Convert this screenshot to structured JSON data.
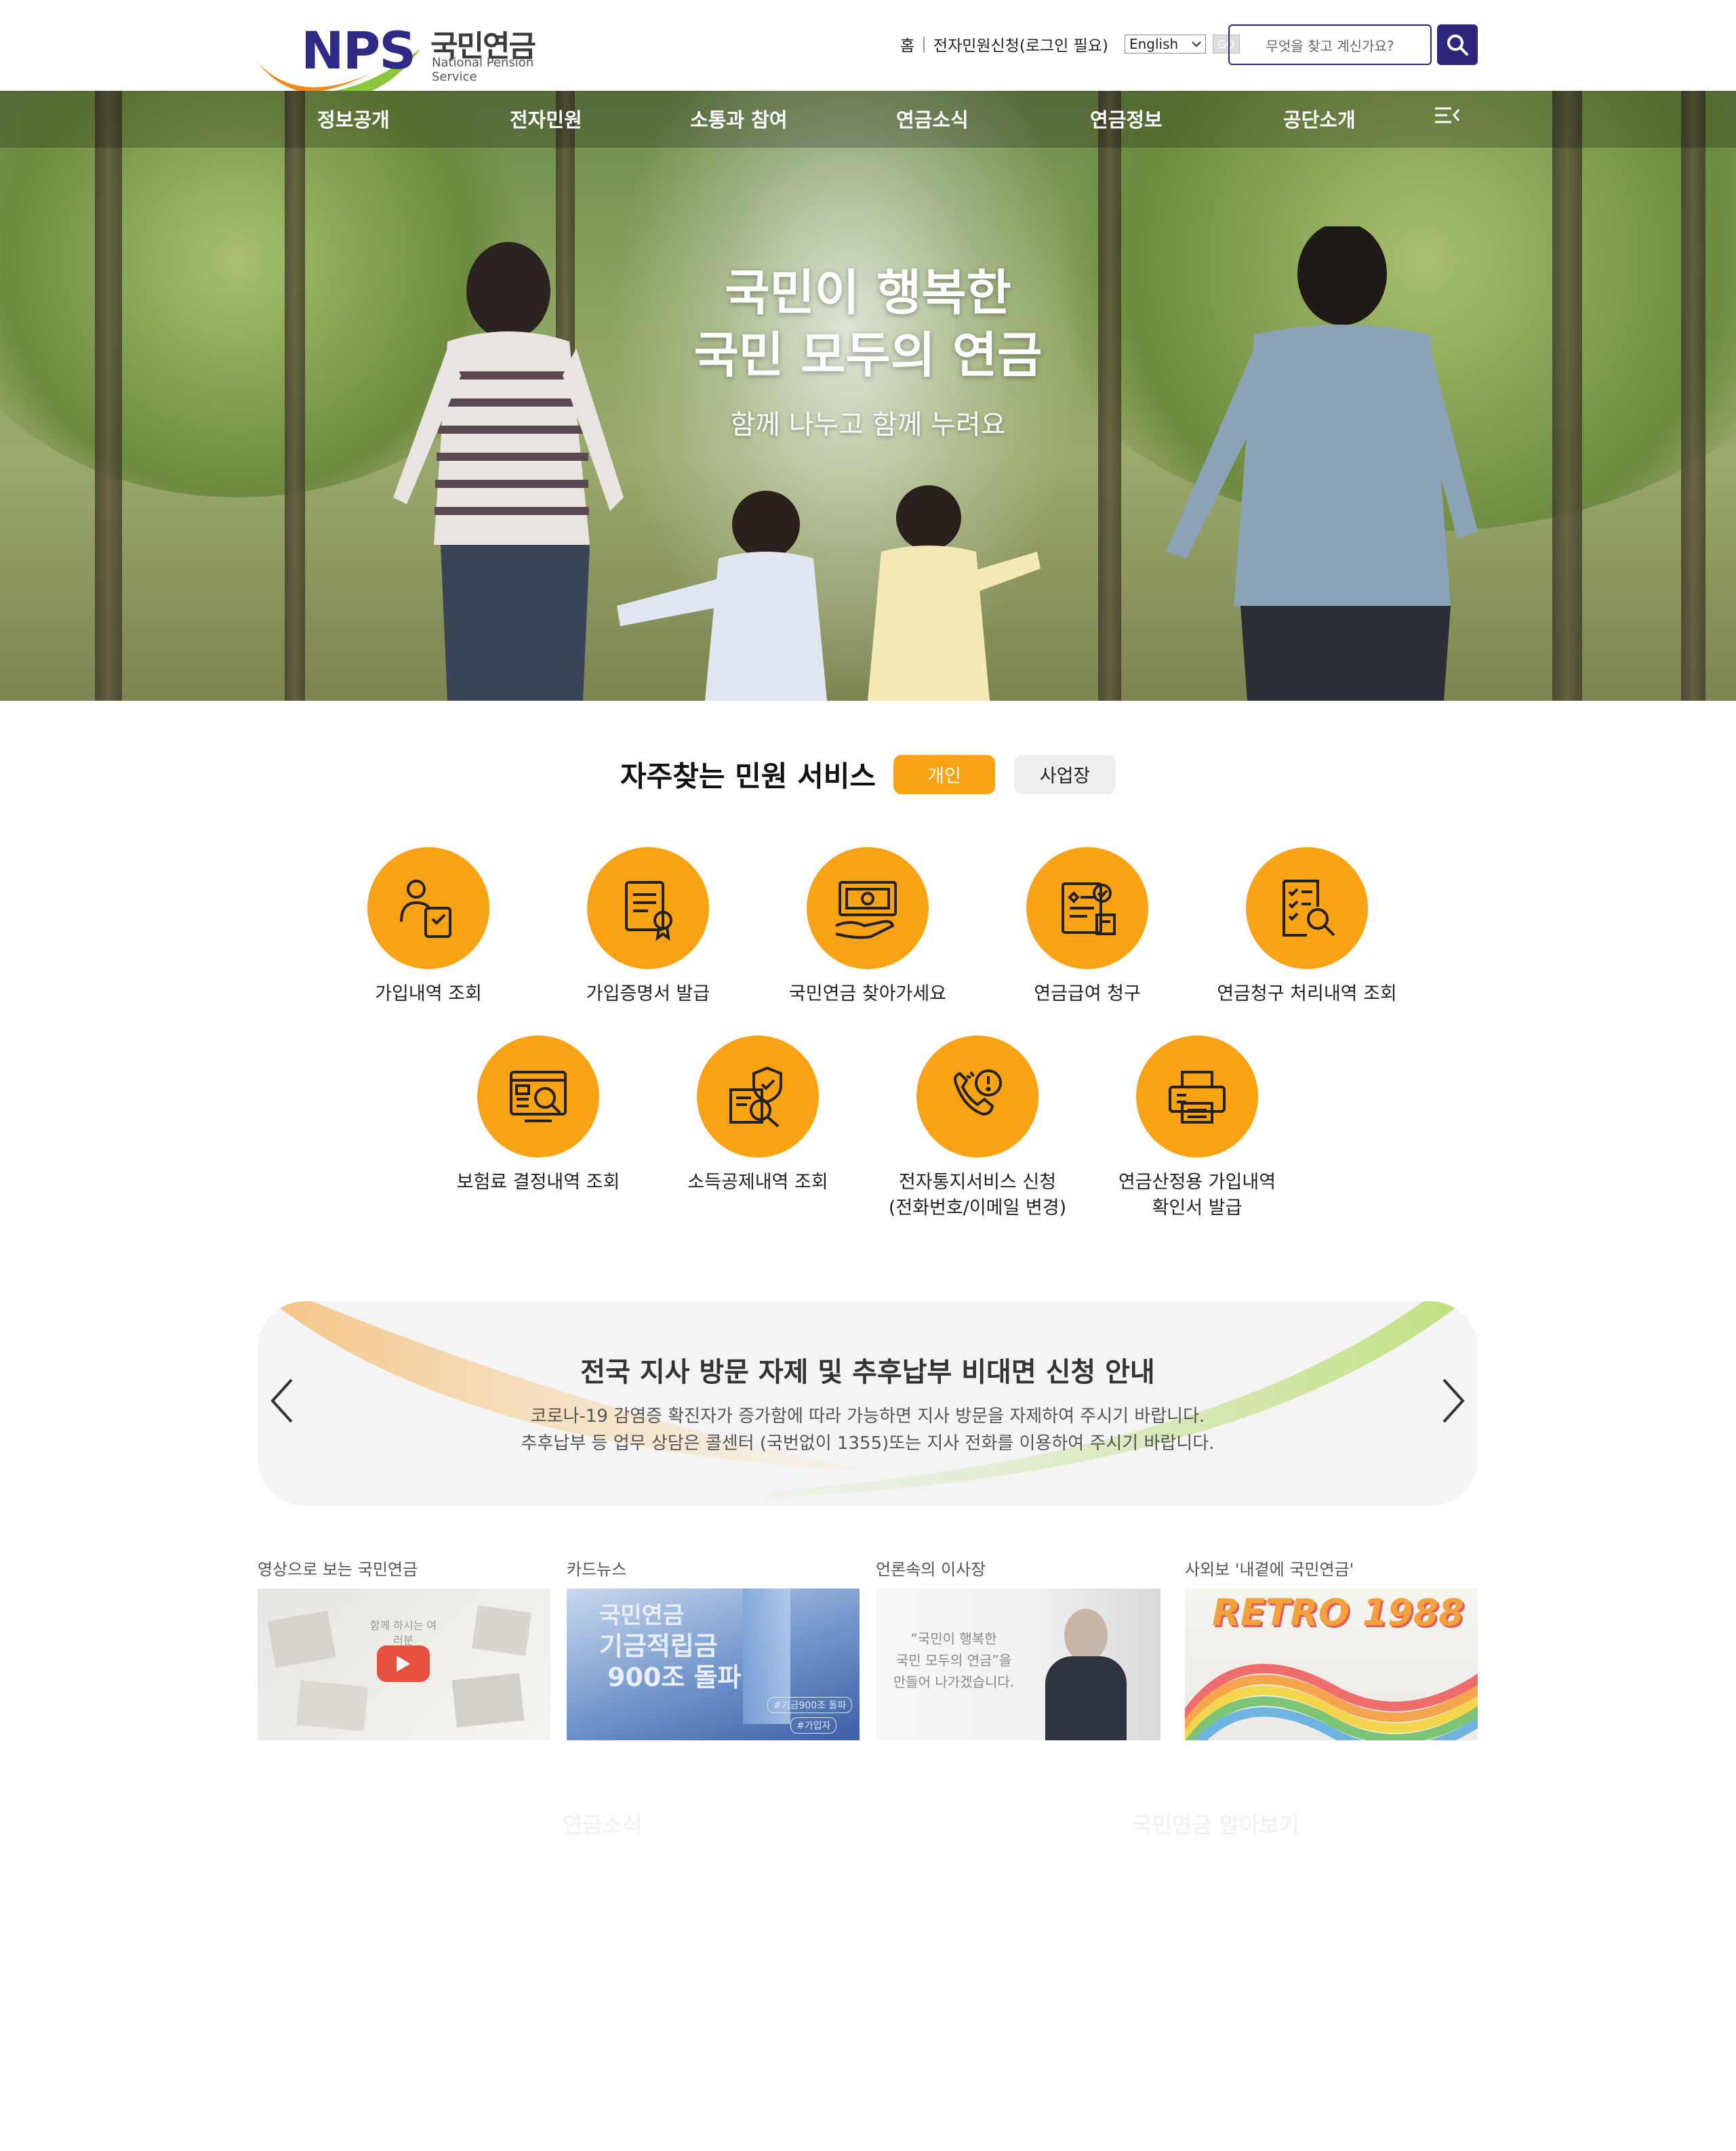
{
  "header": {
    "logo_letters": "NPS",
    "logo_ko": "국민연금",
    "logo_en": "National Pension Service",
    "util_home": "홈",
    "util_eservice": "전자민원신청(로그인 필요)",
    "language_selected": "English",
    "go_label": "GO",
    "search_placeholder": "무엇을 찾고 계신가요?",
    "brand_color": "#2e2679",
    "accent_color": "#f9a213"
  },
  "nav": {
    "items": [
      "정보공개",
      "전자민원",
      "소통과 참여",
      "연금소식",
      "연금정보",
      "공단소개"
    ]
  },
  "hero": {
    "title_line1": "국민이 행복한",
    "title_line2": "국민 모두의 연금",
    "subtitle": "함께 나누고 함께 누려요"
  },
  "services": {
    "title": "자주찾는 민원 서비스",
    "tab_personal": "개인",
    "tab_business": "사업장",
    "items": [
      {
        "label": "가입내역 조회",
        "icon": "person-document-icon"
      },
      {
        "label": "가입증명서 발급",
        "icon": "certificate-icon"
      },
      {
        "label": "국민연금 찾아가세요",
        "icon": "money-hand-icon"
      },
      {
        "label": "연금급여 청구",
        "icon": "claim-document-icon"
      },
      {
        "label": "연금청구 처리내역 조회",
        "icon": "checklist-search-icon"
      },
      {
        "label": "보험료 결정내역 조회",
        "icon": "screen-search-icon"
      },
      {
        "label": "소득공제내역 조회",
        "icon": "shield-search-icon"
      },
      {
        "label": "전자통지서비스 신청",
        "label2": "(전화번호/이메일 변경)",
        "icon": "phone-alert-icon"
      },
      {
        "label": "연금산정용 가입내역",
        "label2": "확인서 발급",
        "icon": "printer-icon"
      }
    ]
  },
  "notice": {
    "title": "전국 지사 방문 자제 및 추후납부 비대면 신청 안내",
    "line1": "코로나-19 감염증 확진자가 증가함에 따라 가능하면 지사 방문을 자제하여 주시기 바랍니다.",
    "line2": "추후납부 등 업무 상담은 콜센터 (국번없이 1355)또는 지사 전화를 이용하여 주시기 바랍니다."
  },
  "media": {
    "cards": [
      {
        "title": "영상으로 보는 국민연금",
        "overlay": "함께 하시는 여러분"
      },
      {
        "title": "카드뉴스",
        "overlay1": "국민연금",
        "overlay2": "기금적립금",
        "overlay3": "900조 돌파",
        "tag1": "#기금900조 돌파",
        "tag2": "#가입자"
      },
      {
        "title": "언론속의 이사장",
        "quote1": "“국민이 행복한",
        "quote2": "국민 모두의 연금”을",
        "quote3": "만들어 나가겠습니다."
      },
      {
        "title": "사외보 '내곁에 국민연금'",
        "overlay": "RETRO 1988"
      }
    ]
  },
  "faded": {
    "left": "연금소식",
    "right": "국민연금 알아보기"
  }
}
